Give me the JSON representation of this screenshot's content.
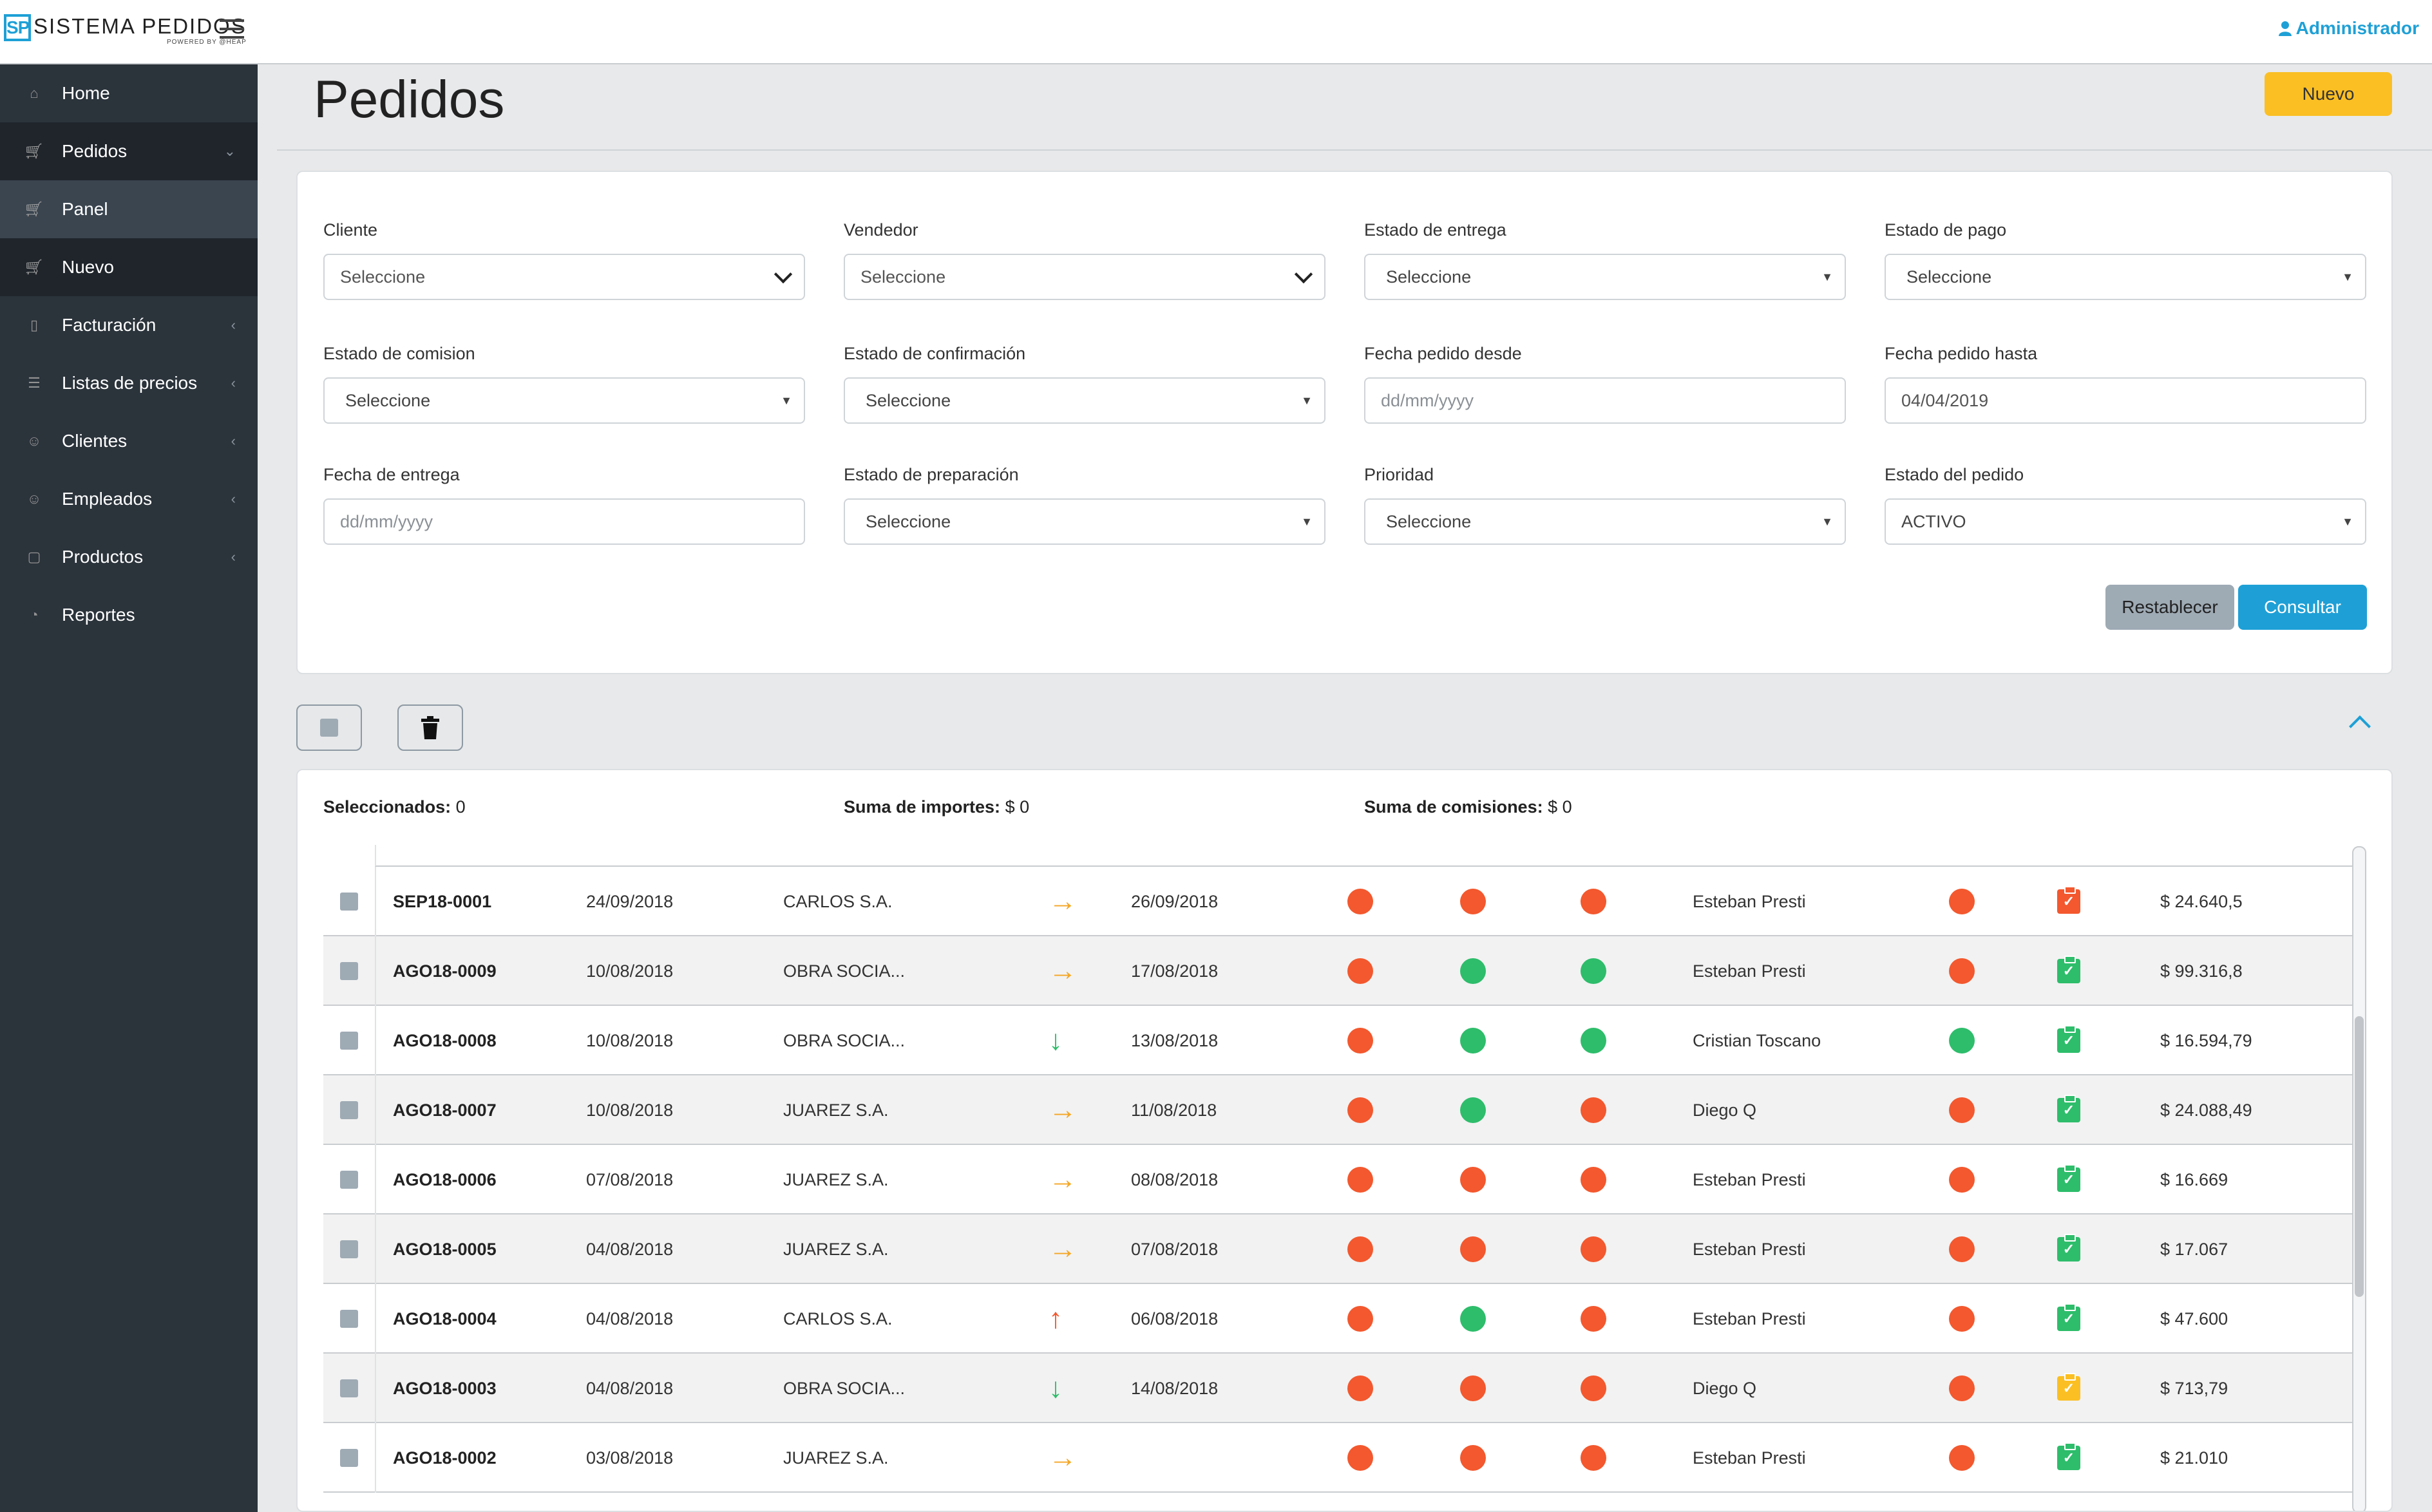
{
  "header": {
    "logo_mark": "SP",
    "logo_title": "SISTEMA PEDIDOS",
    "logo_sub": "POWERED BY @HEAP",
    "user": "Administrador"
  },
  "sidebar": {
    "items": [
      {
        "label": "Home",
        "icon": "home-icon",
        "caret": ""
      },
      {
        "label": "Pedidos",
        "icon": "cart-icon",
        "caret": "⌄"
      },
      {
        "label": "Panel",
        "icon": "cart-icon",
        "caret": ""
      },
      {
        "label": "Nuevo",
        "icon": "cart-icon",
        "caret": ""
      },
      {
        "label": "Facturación",
        "icon": "file-icon",
        "caret": "‹"
      },
      {
        "label": "Listas de precios",
        "icon": "list-icon",
        "caret": "‹"
      },
      {
        "label": "Clientes",
        "icon": "users-icon",
        "caret": "‹"
      },
      {
        "label": "Empleados",
        "icon": "users-icon",
        "caret": "‹"
      },
      {
        "label": "Productos",
        "icon": "box-icon",
        "caret": "‹"
      },
      {
        "label": "Reportes",
        "icon": "chart-icon",
        "caret": ""
      }
    ]
  },
  "page": {
    "title": "Pedidos",
    "new_button": "Nuevo"
  },
  "filters": {
    "cliente": {
      "label": "Cliente",
      "value": "Seleccione"
    },
    "vendedor": {
      "label": "Vendedor",
      "value": "Seleccione"
    },
    "estado_entrega": {
      "label": "Estado de entrega",
      "value": "Seleccione"
    },
    "estado_pago": {
      "label": "Estado de pago",
      "value": "Seleccione"
    },
    "estado_comision": {
      "label": "Estado de comision",
      "value": "Seleccione"
    },
    "estado_confirmacion": {
      "label": "Estado de confirmación",
      "value": "Seleccione"
    },
    "fecha_desde": {
      "label": "Fecha pedido desde",
      "placeholder": "dd/mm/yyyy"
    },
    "fecha_hasta": {
      "label": "Fecha pedido hasta",
      "value": "04/04/2019"
    },
    "fecha_entrega": {
      "label": "Fecha de entrega",
      "placeholder": "dd/mm/yyyy"
    },
    "estado_preparacion": {
      "label": "Estado de preparación",
      "value": "Seleccione"
    },
    "prioridad": {
      "label": "Prioridad",
      "value": "Seleccione"
    },
    "estado_pedido": {
      "label": "Estado del pedido",
      "value": "ACTIVO"
    },
    "reset_button": "Restablecer",
    "query_button": "Consultar"
  },
  "summary": {
    "selected_label": "Seleccionados:",
    "selected_value": "0",
    "importes_label": "Suma de importes:",
    "importes_value": "$ 0",
    "comisiones_label": "Suma de comisiones:",
    "comisiones_value": "$ 0"
  },
  "colors": {
    "accent": "#1ea0d6",
    "status_red": "#f3582e",
    "status_green": "#2ebd6b",
    "warning": "#fbbf24",
    "arrow_right": "#f5a623",
    "arrow_up": "#f3582e",
    "arrow_down": "#2ebd6b"
  },
  "orders": [
    {
      "id": "SEP18-0001",
      "date": "24/09/2018",
      "client": "CARLOS S.A.",
      "priority": "right",
      "delivery": "26/09/2018",
      "s1": "red",
      "s2": "red",
      "s3": "red",
      "seller": "Esteban Presti",
      "s4": "red",
      "clip": "red",
      "amount": "$ 24.640,5"
    },
    {
      "id": "AGO18-0009",
      "date": "10/08/2018",
      "client": "OBRA SOCIA...",
      "priority": "right",
      "delivery": "17/08/2018",
      "s1": "red",
      "s2": "green",
      "s3": "green",
      "seller": "Esteban Presti",
      "s4": "red",
      "clip": "green",
      "amount": "$ 99.316,8"
    },
    {
      "id": "AGO18-0008",
      "date": "10/08/2018",
      "client": "OBRA SOCIA...",
      "priority": "down",
      "delivery": "13/08/2018",
      "s1": "red",
      "s2": "green",
      "s3": "green",
      "seller": "Cristian Toscano",
      "s4": "green",
      "clip": "green",
      "amount": "$ 16.594,79"
    },
    {
      "id": "AGO18-0007",
      "date": "10/08/2018",
      "client": "JUAREZ S.A.",
      "priority": "right",
      "delivery": "11/08/2018",
      "s1": "red",
      "s2": "green",
      "s3": "red",
      "seller": "Diego Q",
      "s4": "red",
      "clip": "green",
      "amount": "$ 24.088,49"
    },
    {
      "id": "AGO18-0006",
      "date": "07/08/2018",
      "client": "JUAREZ S.A.",
      "priority": "right",
      "delivery": "08/08/2018",
      "s1": "red",
      "s2": "red",
      "s3": "red",
      "seller": "Esteban Presti",
      "s4": "red",
      "clip": "green",
      "amount": "$ 16.669"
    },
    {
      "id": "AGO18-0005",
      "date": "04/08/2018",
      "client": "JUAREZ S.A.",
      "priority": "right",
      "delivery": "07/08/2018",
      "s1": "red",
      "s2": "red",
      "s3": "red",
      "seller": "Esteban Presti",
      "s4": "red",
      "clip": "green",
      "amount": "$ 17.067"
    },
    {
      "id": "AGO18-0004",
      "date": "04/08/2018",
      "client": "CARLOS S.A.",
      "priority": "up",
      "delivery": "06/08/2018",
      "s1": "red",
      "s2": "green",
      "s3": "red",
      "seller": "Esteban Presti",
      "s4": "red",
      "clip": "green",
      "amount": "$ 47.600"
    },
    {
      "id": "AGO18-0003",
      "date": "04/08/2018",
      "client": "OBRA SOCIA...",
      "priority": "down",
      "delivery": "14/08/2018",
      "s1": "red",
      "s2": "red",
      "s3": "red",
      "seller": "Diego Q",
      "s4": "red",
      "clip": "yellow",
      "amount": "$ 713,79"
    },
    {
      "id": "AGO18-0002",
      "date": "03/08/2018",
      "client": "JUAREZ S.A.",
      "priority": "right",
      "delivery": "",
      "s1": "red",
      "s2": "red",
      "s3": "red",
      "seller": "Esteban Presti",
      "s4": "red",
      "clip": "green",
      "amount": "$ 21.010"
    }
  ]
}
